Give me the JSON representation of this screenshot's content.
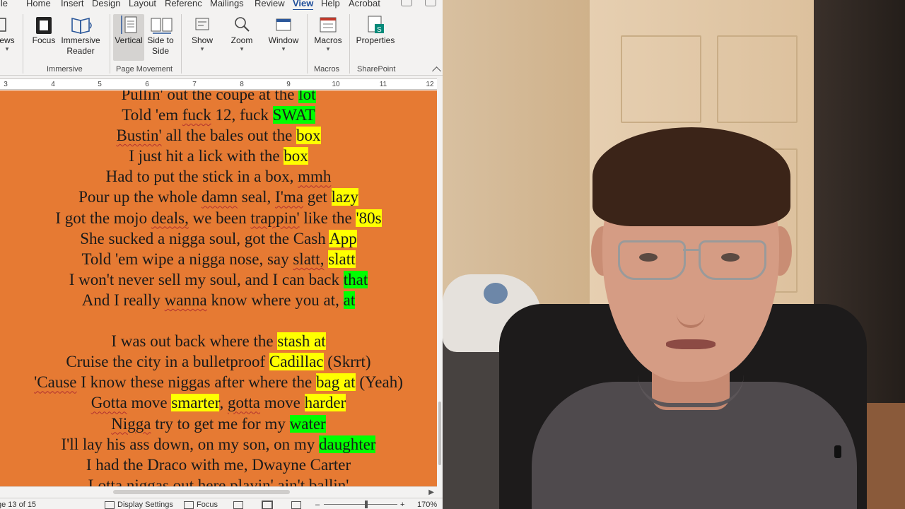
{
  "word": {
    "tabs": [
      "ile",
      "Home",
      "Insert",
      "Design",
      "Layout",
      "Referenc",
      "Mailings",
      "Review",
      "View",
      "Help",
      "Acrobat"
    ],
    "active_tab": "View",
    "ribbon": {
      "views_label": "ews",
      "focus_label": "Focus",
      "immersive_reader_label": "Immersive Reader",
      "vertical_label": "Vertical",
      "side_to_side_label": "Side to Side",
      "show_label": "Show",
      "zoom_label": "Zoom",
      "window_label": "Window",
      "macros_label": "Macros",
      "properties_label": "Properties",
      "groups": {
        "immersive": "Immersive",
        "page_movement": "Page Movement",
        "macros": "Macros",
        "sharepoint": "SharePoint"
      }
    },
    "ruler": [
      "3",
      "4",
      "5",
      "6",
      "7",
      "8",
      "9",
      "10",
      "11",
      "12"
    ],
    "lyrics": [
      [
        {
          "t": "Pullin' out the coupe at the "
        },
        {
          "t": "lot",
          "hl": "g"
        }
      ],
      [
        {
          "t": "Told 'em "
        },
        {
          "t": "fuck",
          "sq": true
        },
        {
          "t": " 12, fuck "
        },
        {
          "t": "SWAT",
          "hl": "g"
        }
      ],
      [
        {
          "t": "Bustin'",
          "sq": true
        },
        {
          "t": " all the bales out the "
        },
        {
          "t": "box",
          "hl": "y"
        }
      ],
      [
        {
          "t": "I just hit a lick with the "
        },
        {
          "t": "box",
          "hl": "y"
        }
      ],
      [
        {
          "t": "Had to put the stick in a box, "
        },
        {
          "t": "mmh",
          "sq": true
        }
      ],
      [
        {
          "t": "Pour up the whole "
        },
        {
          "t": "damn",
          "sq": true
        },
        {
          "t": " seal, "
        },
        {
          "t": "I'ma",
          "sq": true
        },
        {
          "t": " get "
        },
        {
          "t": "lazy",
          "hl": "y"
        }
      ],
      [
        {
          "t": "I got the mojo "
        },
        {
          "t": "deals,",
          "sq": true
        },
        {
          "t": " we been "
        },
        {
          "t": "trappin'",
          "sq": true
        },
        {
          "t": " like the "
        },
        {
          "t": "'80s",
          "hl": "y"
        }
      ],
      [
        {
          "t": "She sucked a nigga soul, got the Cash "
        },
        {
          "t": "App",
          "hl": "y"
        }
      ],
      [
        {
          "t": "Told 'em wipe a nigga nose, say "
        },
        {
          "t": "slatt,",
          "sq": true
        },
        {
          "t": " "
        },
        {
          "t": "slatt",
          "hl": "y"
        }
      ],
      [
        {
          "t": "I won't never sell my soul, and I can back "
        },
        {
          "t": "that",
          "hl": "g"
        }
      ],
      [
        {
          "t": "And I really "
        },
        {
          "t": "wanna",
          "sq": true
        },
        {
          "t": " know where you at, "
        },
        {
          "t": "at",
          "hl": "g"
        }
      ],
      [
        {
          "t": " "
        }
      ],
      [
        {
          "t": "I was out back where the "
        },
        {
          "t": "stash at",
          "hl": "y"
        }
      ],
      [
        {
          "t": "Cruise the city in a bulletproof "
        },
        {
          "t": "Cadillac",
          "hl": "y"
        },
        {
          "t": " (Skrrt)"
        }
      ],
      [
        {
          "t": "'Cause",
          "sq": true
        },
        {
          "t": " I know these niggas after where the "
        },
        {
          "t": "bag at",
          "hl": "y"
        },
        {
          "t": " (Yeah)"
        }
      ],
      [
        {
          "t": "Gotta",
          "sq": true
        },
        {
          "t": " move "
        },
        {
          "t": "smarter",
          "hl": "y"
        },
        {
          "t": ", "
        },
        {
          "t": "gotta",
          "sq": true
        },
        {
          "t": " move "
        },
        {
          "t": "harder",
          "hl": "y"
        }
      ],
      [
        {
          "t": "Nigga",
          "sq": true
        },
        {
          "t": " try to get me for my "
        },
        {
          "t": "water",
          "hl": "g"
        }
      ],
      [
        {
          "t": "I'll lay his ass down, on my son, on my "
        },
        {
          "t": "daughter",
          "hl": "g"
        }
      ],
      [
        {
          "t": "I had the Draco with me, Dwayne Carter"
        }
      ],
      [
        {
          "t": "Lotta niggas out here playin' ain't ballin'"
        }
      ]
    ],
    "status": {
      "page": "ge 13 of 15",
      "display_settings": "Display Settings",
      "focus": "Focus",
      "zoom_level": "170%"
    }
  }
}
